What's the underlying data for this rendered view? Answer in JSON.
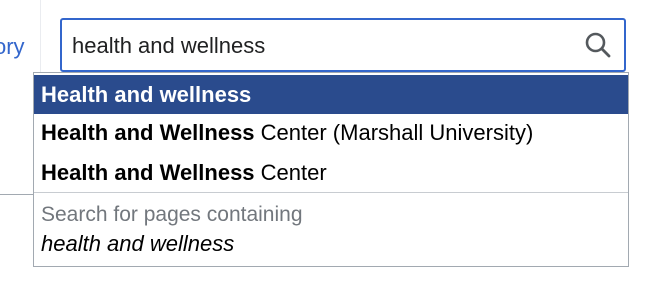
{
  "left_tab": {
    "label_fragment": "ory"
  },
  "search": {
    "value": "health and wellness",
    "icon": "search-icon"
  },
  "suggestions": [
    {
      "bold": "Health and wellness",
      "rest": "",
      "selected": true
    },
    {
      "bold": "Health and Wellness",
      "rest": " Center (Marshall University)",
      "selected": false
    },
    {
      "bold": "Health and Wellness",
      "rest": " Center",
      "selected": false
    }
  ],
  "special": {
    "line1": "Search for pages containing",
    "line2": "health and wellness"
  },
  "colors": {
    "accent": "#3366cc",
    "selected_bg": "#2a4b8d",
    "border": "#a2a9b1",
    "muted_text": "#72777d"
  }
}
